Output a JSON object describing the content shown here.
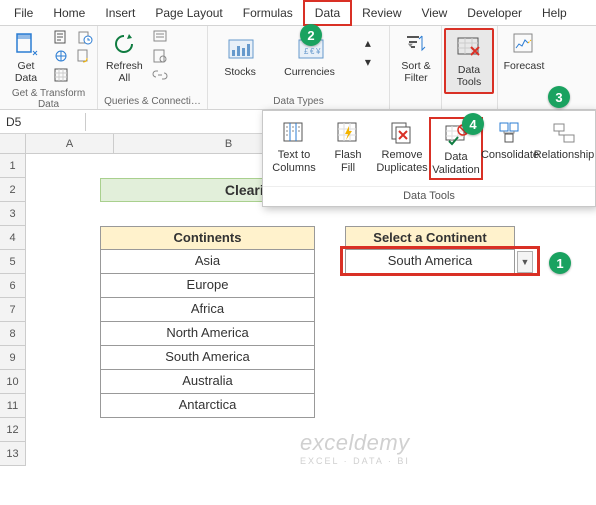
{
  "menu": {
    "items": [
      "File",
      "Home",
      "Insert",
      "Page Layout",
      "Formulas",
      "Data",
      "Review",
      "View",
      "Developer",
      "Help"
    ],
    "active": "Data"
  },
  "ribbon": {
    "get_data": "Get\nData",
    "refresh_all": "Refresh\nAll",
    "stocks": "Stocks",
    "currencies": "Currencies",
    "sort_filter": "Sort &\nFilter",
    "data_tools": "Data\nTools",
    "forecast": "Forecast",
    "grp1": "Get & Transform Data",
    "grp2": "Queries & Connecti…",
    "grp3": "Data Types"
  },
  "dt_panel": {
    "text_to_columns": "Text to\nColumns",
    "flash_fill": "Flash\nFill",
    "remove_dup": "Remove\nDuplicates",
    "data_validation": "Data\nValidation",
    "consolidate": "Consolidate",
    "relationships": "Relationship",
    "label": "Data Tools"
  },
  "namebox": "D5",
  "cols": {
    "A": 88,
    "B": 230,
    "C": 30,
    "D": 170,
    "E": 50
  },
  "title": "Clearing Drop Down List",
  "continents_header": "Continents",
  "select_header": "Select a Continent",
  "continents": [
    "Asia",
    "Europe",
    "Africa",
    "North America",
    "South America",
    "Australia",
    "Antarctica"
  ],
  "selection": "South America",
  "badges": {
    "1": "1",
    "2": "2",
    "3": "3",
    "4": "4"
  },
  "watermark": {
    "main": "exceldemy",
    "sub": "EXCEL · DATA · BI"
  }
}
